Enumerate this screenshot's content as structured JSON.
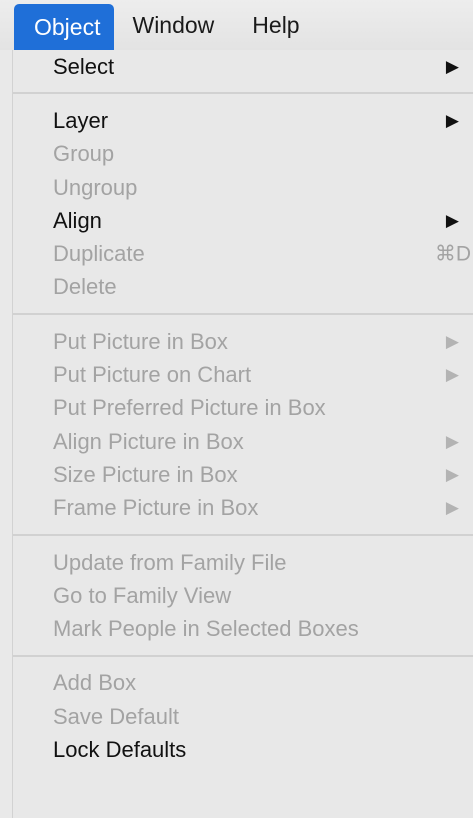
{
  "menubar": {
    "items": [
      {
        "label": "Object",
        "active": true
      },
      {
        "label": "Window"
      },
      {
        "label": "Help"
      }
    ]
  },
  "menu": {
    "groups": [
      [
        {
          "label": "Select",
          "enabled": true,
          "submenu": true
        }
      ],
      [
        {
          "label": "Layer",
          "enabled": true,
          "submenu": true
        },
        {
          "label": "Group",
          "enabled": false
        },
        {
          "label": "Ungroup",
          "enabled": false
        },
        {
          "label": "Align",
          "enabled": true,
          "submenu": true
        },
        {
          "label": "Duplicate",
          "enabled": false,
          "shortcut": "⌘D"
        },
        {
          "label": "Delete",
          "enabled": false
        }
      ],
      [
        {
          "label": "Put Picture in Box",
          "enabled": false,
          "submenu": true
        },
        {
          "label": "Put Picture on Chart",
          "enabled": false,
          "submenu": true
        },
        {
          "label": "Put Preferred Picture in Box",
          "enabled": false
        },
        {
          "label": "Align Picture in Box",
          "enabled": false,
          "submenu": true
        },
        {
          "label": "Size Picture in Box",
          "enabled": false,
          "submenu": true
        },
        {
          "label": "Frame Picture in Box",
          "enabled": false,
          "submenu": true
        }
      ],
      [
        {
          "label": "Update from Family File",
          "enabled": false
        },
        {
          "label": "Go to Family View",
          "enabled": false
        },
        {
          "label": "Mark People in Selected Boxes",
          "enabled": false
        }
      ],
      [
        {
          "label": "Add Box",
          "enabled": false
        },
        {
          "label": "Save Default",
          "enabled": false
        },
        {
          "label": "Lock Defaults",
          "enabled": true
        }
      ]
    ],
    "submenu_glyph": "▶"
  }
}
